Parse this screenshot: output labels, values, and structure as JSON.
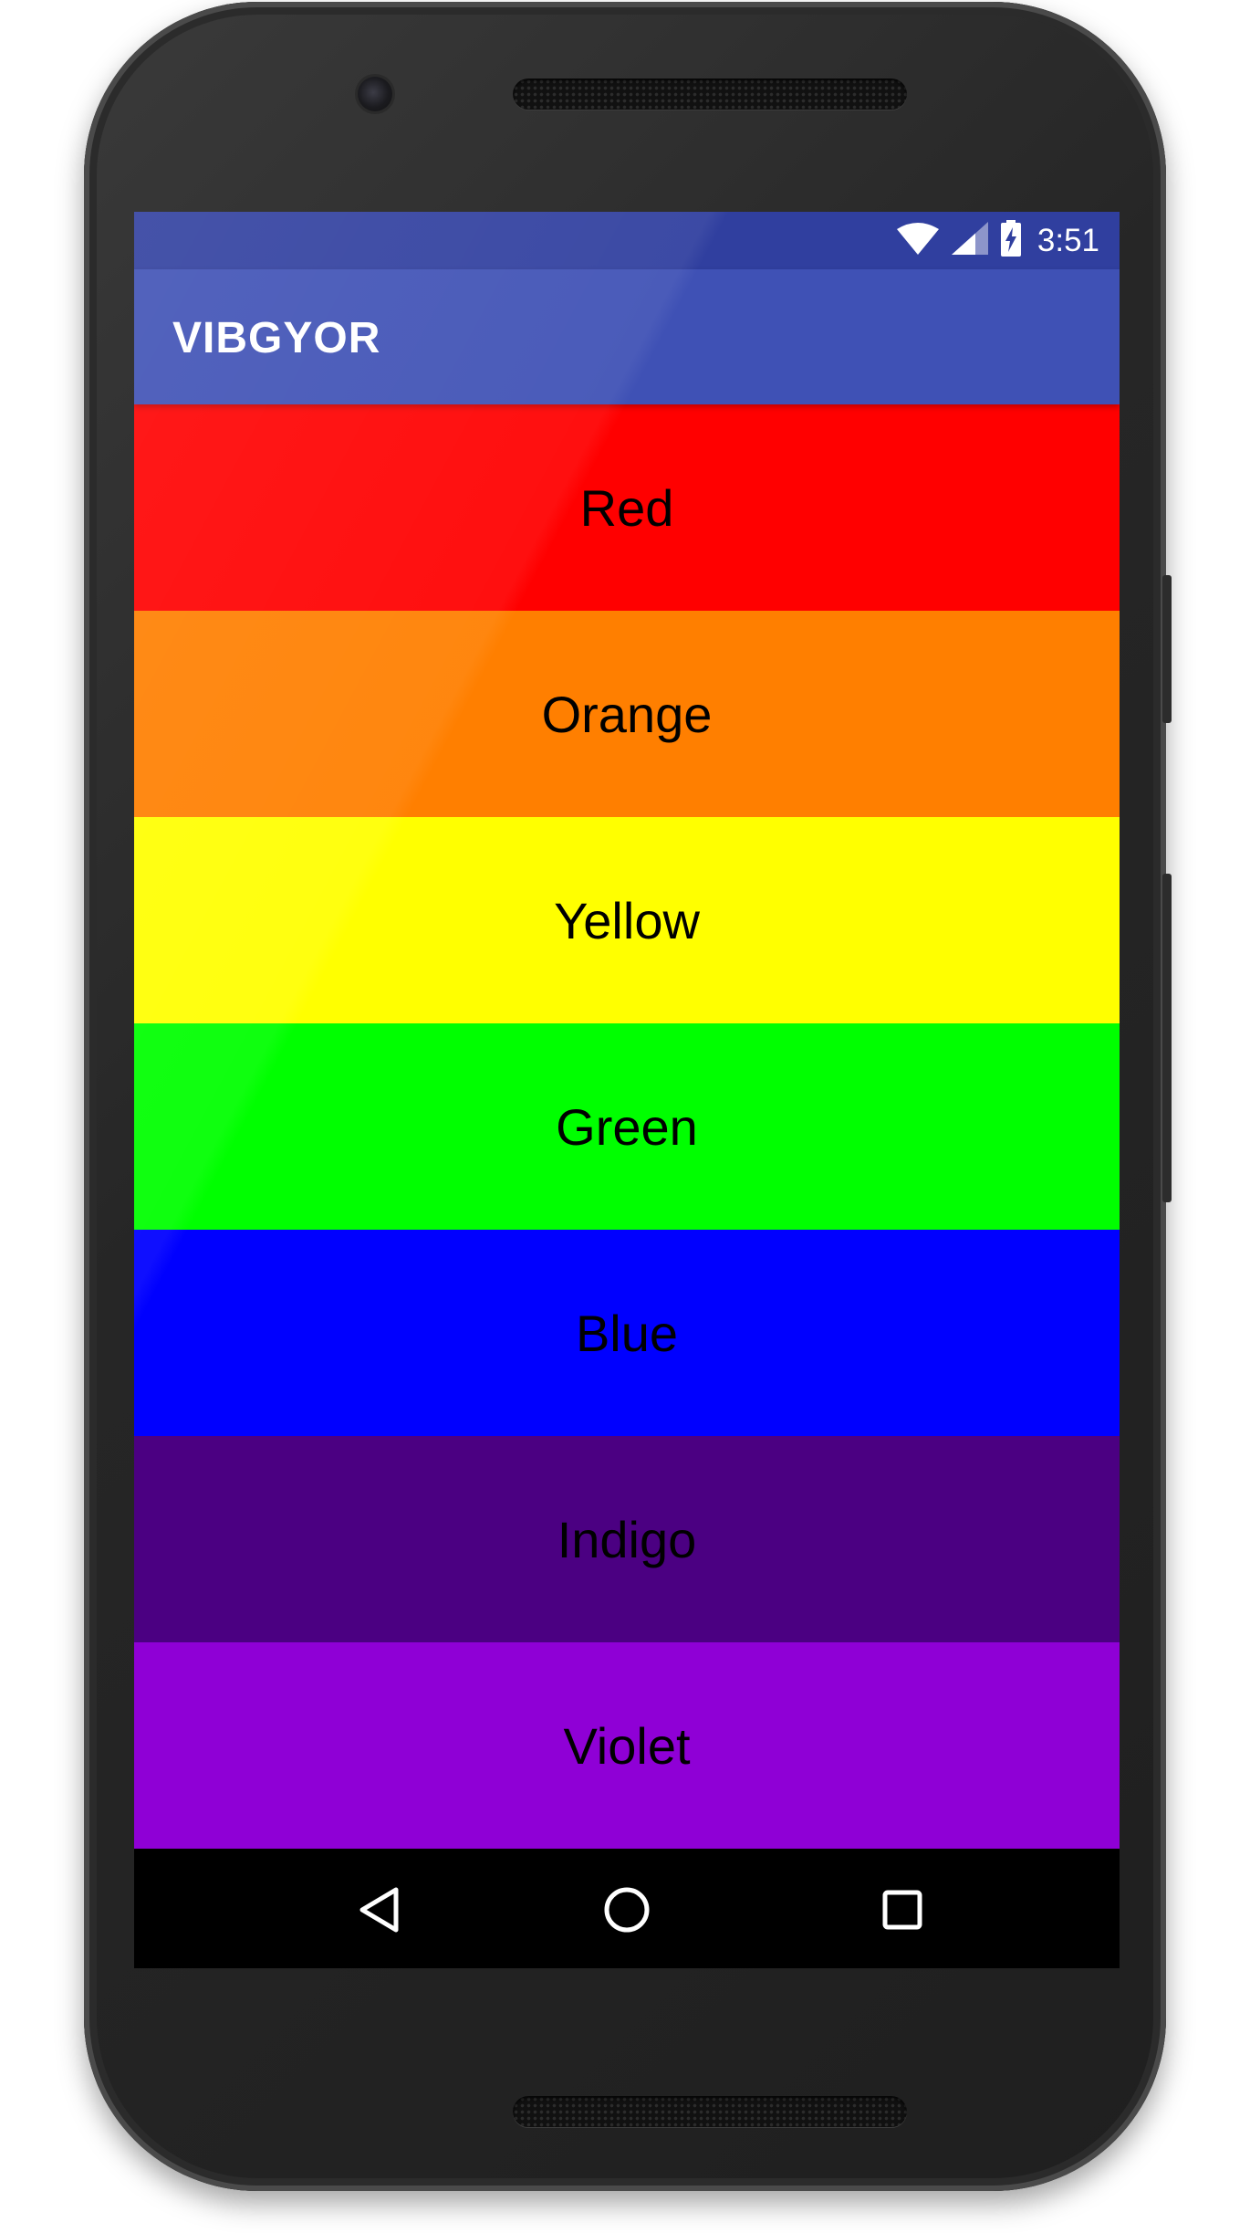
{
  "status_bar": {
    "time": "3:51",
    "icons": [
      "wifi-icon",
      "signal-icon",
      "battery-charging-icon"
    ]
  },
  "app_bar": {
    "title": "VIBGYOR"
  },
  "colors": [
    {
      "label": "Red",
      "hex": "#ff0000"
    },
    {
      "label": "Orange",
      "hex": "#ff7f00"
    },
    {
      "label": "Yellow",
      "hex": "#ffff00"
    },
    {
      "label": "Green",
      "hex": "#00ff00"
    },
    {
      "label": "Blue",
      "hex": "#0000ff"
    },
    {
      "label": "Indigo",
      "hex": "#4b0082"
    },
    {
      "label": "Violet",
      "hex": "#8f00d6"
    }
  ],
  "theme": {
    "status_bar": "#303f9f",
    "app_bar": "#3f51b5"
  },
  "nav_bar": {
    "icons": [
      "back-icon",
      "home-icon",
      "recents-icon"
    ]
  }
}
